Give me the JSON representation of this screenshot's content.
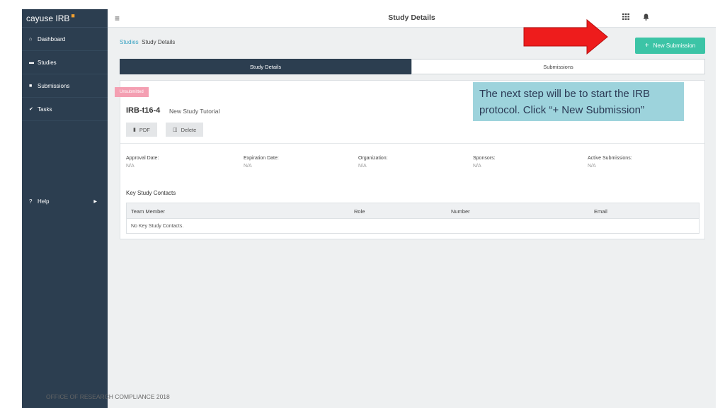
{
  "sidebar": {
    "brand": "cayuse IRB",
    "items": [
      {
        "icon": "home-icon",
        "glyph": "⌂",
        "label": "Dashboard"
      },
      {
        "icon": "folder-icon",
        "glyph": "▬",
        "label": "Studies"
      },
      {
        "icon": "document-icon",
        "glyph": "■",
        "label": "Submissions"
      },
      {
        "icon": "check-icon",
        "glyph": "✔",
        "label": "Tasks"
      }
    ],
    "help": {
      "icon": "question-icon",
      "glyph": "?",
      "label": "Help"
    }
  },
  "header": {
    "title": "Study Details",
    "apps_icon": "grid-icon",
    "bell_icon": "bell-icon"
  },
  "breadcrumb": {
    "link": "Studies",
    "current": "Study Details"
  },
  "actions": {
    "new_submission": "New Submission",
    "new_submission_color": "#3cc4a6"
  },
  "tabs": [
    {
      "label": "Study Details",
      "active": true
    },
    {
      "label": "Submissions",
      "active": false
    }
  ],
  "study": {
    "status": "Unsubmitted",
    "status_color": "#f49fb2",
    "id": "IRB-t16-4",
    "name": "New Study Tutorial",
    "buttons": {
      "pdf": "PDF",
      "delete": "Delete"
    }
  },
  "meta": [
    {
      "label": "Approval Date:",
      "value": "N/A"
    },
    {
      "label": "Expiration Date:",
      "value": "N/A"
    },
    {
      "label": "Organization:",
      "value": "N/A"
    },
    {
      "label": "Sponsors:",
      "value": "N/A"
    },
    {
      "label": "Active Submissions:",
      "value": "N/A"
    }
  ],
  "contacts": {
    "title": "Key Study Contacts",
    "columns": [
      "Team Member",
      "Role",
      "Number",
      "Email"
    ],
    "empty": "No Key Study Contacts."
  },
  "annotation": {
    "line1": "The next step will be to start the IRB",
    "line2": "protocol. Click “+ New Submission”",
    "arrow_color": "#ee1c1c"
  },
  "footer": "OFFICE OF RESEARCH COMPLIANCE 2018"
}
